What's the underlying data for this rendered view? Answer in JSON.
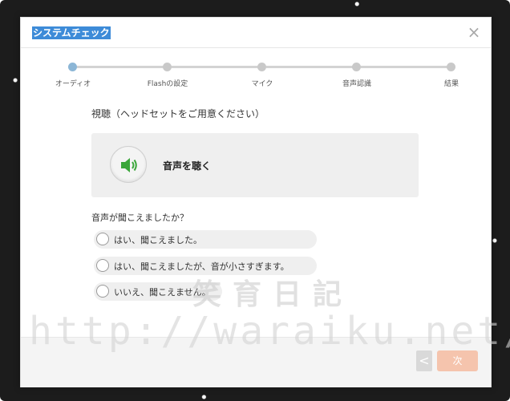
{
  "window": {
    "title": "システムチェック",
    "close_icon": "close-icon"
  },
  "stepper": {
    "steps": [
      {
        "label": "オーディオ",
        "active": true
      },
      {
        "label": "Flashの設定",
        "active": false
      },
      {
        "label": "マイク",
        "active": false
      },
      {
        "label": "音声認識",
        "active": false
      },
      {
        "label": "結果",
        "active": false
      }
    ]
  },
  "listen": {
    "section_title": "視聴（ヘッドセットをご用意ください）",
    "button_icon": "speaker-icon",
    "button_label": "音声を聴く",
    "icon_color": "#3aa63a"
  },
  "question": {
    "text": "音声が聞こえましたか？",
    "options": [
      {
        "label": "はい、聞こえました。"
      },
      {
        "label": "はい、聞こえましたが、音が小さすぎます。"
      },
      {
        "label": "いいえ、聞こえません。"
      }
    ]
  },
  "footer": {
    "back_icon": "chevron-left-icon",
    "back_label": "<",
    "next_label": "次",
    "next_color": "#f5c4ad"
  },
  "watermark": {
    "title": "笑育日記",
    "url": "http://waraiku.net/"
  }
}
